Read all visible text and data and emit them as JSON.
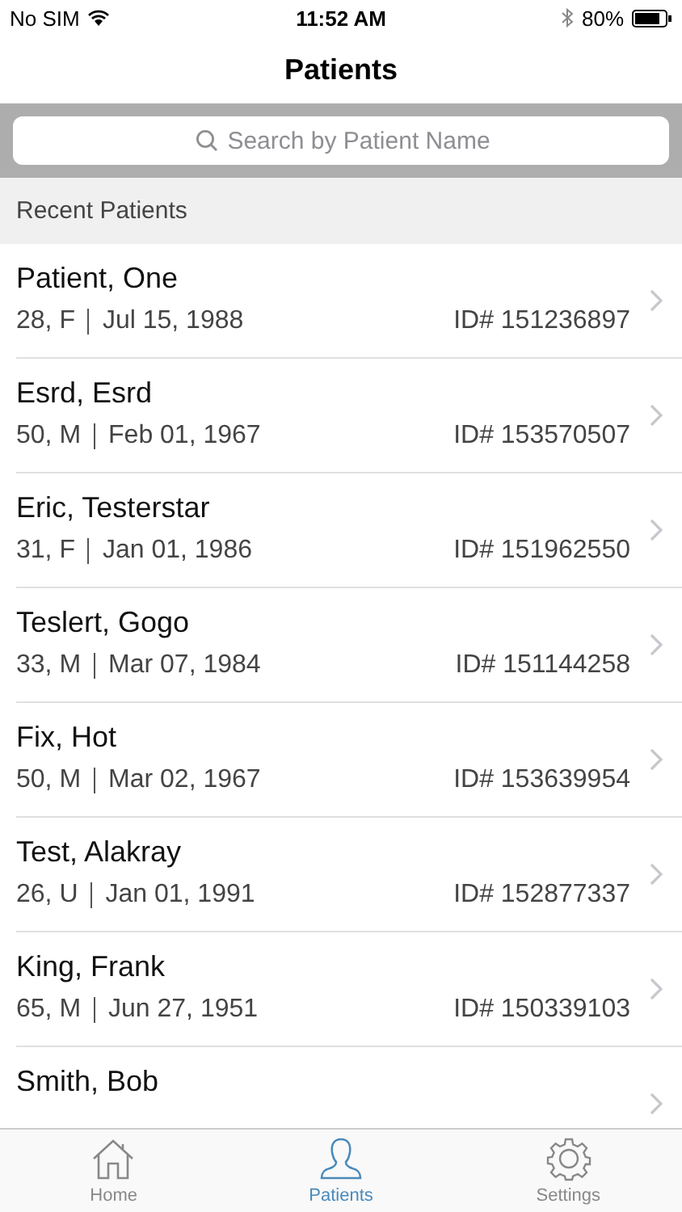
{
  "status_bar": {
    "carrier": "No SIM",
    "time": "11:52 AM",
    "battery": "80%"
  },
  "title": "Patients",
  "search": {
    "placeholder": "Search by Patient Name"
  },
  "section": "Recent Patients",
  "patients": [
    {
      "name": "Patient, One",
      "age_sex": "28, F",
      "dob": "Jul 15, 1988",
      "id": "ID# 151236897"
    },
    {
      "name": "Esrd, Esrd",
      "age_sex": "50, M",
      "dob": "Feb 01, 1967",
      "id": "ID# 153570507"
    },
    {
      "name": "Eric, Testerstar",
      "age_sex": "31, F",
      "dob": "Jan 01, 1986",
      "id": "ID# 151962550"
    },
    {
      "name": "Teslert, Gogo",
      "age_sex": "33, M",
      "dob": "Mar 07, 1984",
      "id": "ID# 151144258"
    },
    {
      "name": "Fix, Hot",
      "age_sex": "50, M",
      "dob": "Mar 02, 1967",
      "id": "ID# 153639954"
    },
    {
      "name": "Test, Alakray",
      "age_sex": "26, U",
      "dob": "Jan 01, 1991",
      "id": "ID# 152877337"
    },
    {
      "name": "King, Frank",
      "age_sex": "65, M",
      "dob": "Jun 27, 1951",
      "id": "ID# 150339103"
    },
    {
      "name": "Smith, Bob"
    }
  ],
  "tabs": [
    {
      "label": "Home",
      "kind": "home",
      "selected": false
    },
    {
      "label": "Patients",
      "kind": "person",
      "selected": true
    },
    {
      "label": "Settings",
      "kind": "gear",
      "selected": false
    }
  ]
}
